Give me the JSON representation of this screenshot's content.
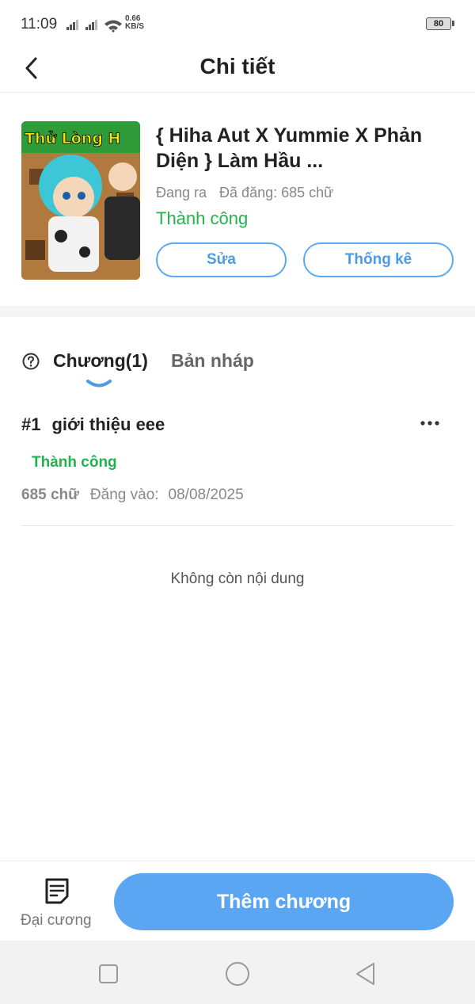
{
  "status_bar": {
    "time": "11:09",
    "net_speed_value": "0.66",
    "net_speed_unit": "KB/S",
    "battery": "80"
  },
  "header": {
    "title": "Chi tiết"
  },
  "book": {
    "title": "{ Hiha Aut X Yummie X Phản Diện } Làm Hầu ...",
    "cover_text": "Thử Lòng H",
    "state": "Đang ra",
    "published": "Đã đăng: 685 chữ",
    "status": "Thành công",
    "edit_label": "Sửa",
    "stats_label": "Thống kê"
  },
  "tabs": {
    "chapters": "Chương(1)",
    "drafts": "Bản nháp"
  },
  "chapters": [
    {
      "number": "#1",
      "title": "giới thiệu eee",
      "status": "Thành công",
      "words": "685 chữ",
      "posted_label": "Đăng vào:",
      "date": "08/08/2025"
    }
  ],
  "empty_message": "Không còn nội dung",
  "bottom_bar": {
    "outline_label": "Đại cương",
    "add_chapter_label": "Thêm chương"
  },
  "colors": {
    "accent": "#5aa6f3",
    "success": "#22b24c"
  }
}
